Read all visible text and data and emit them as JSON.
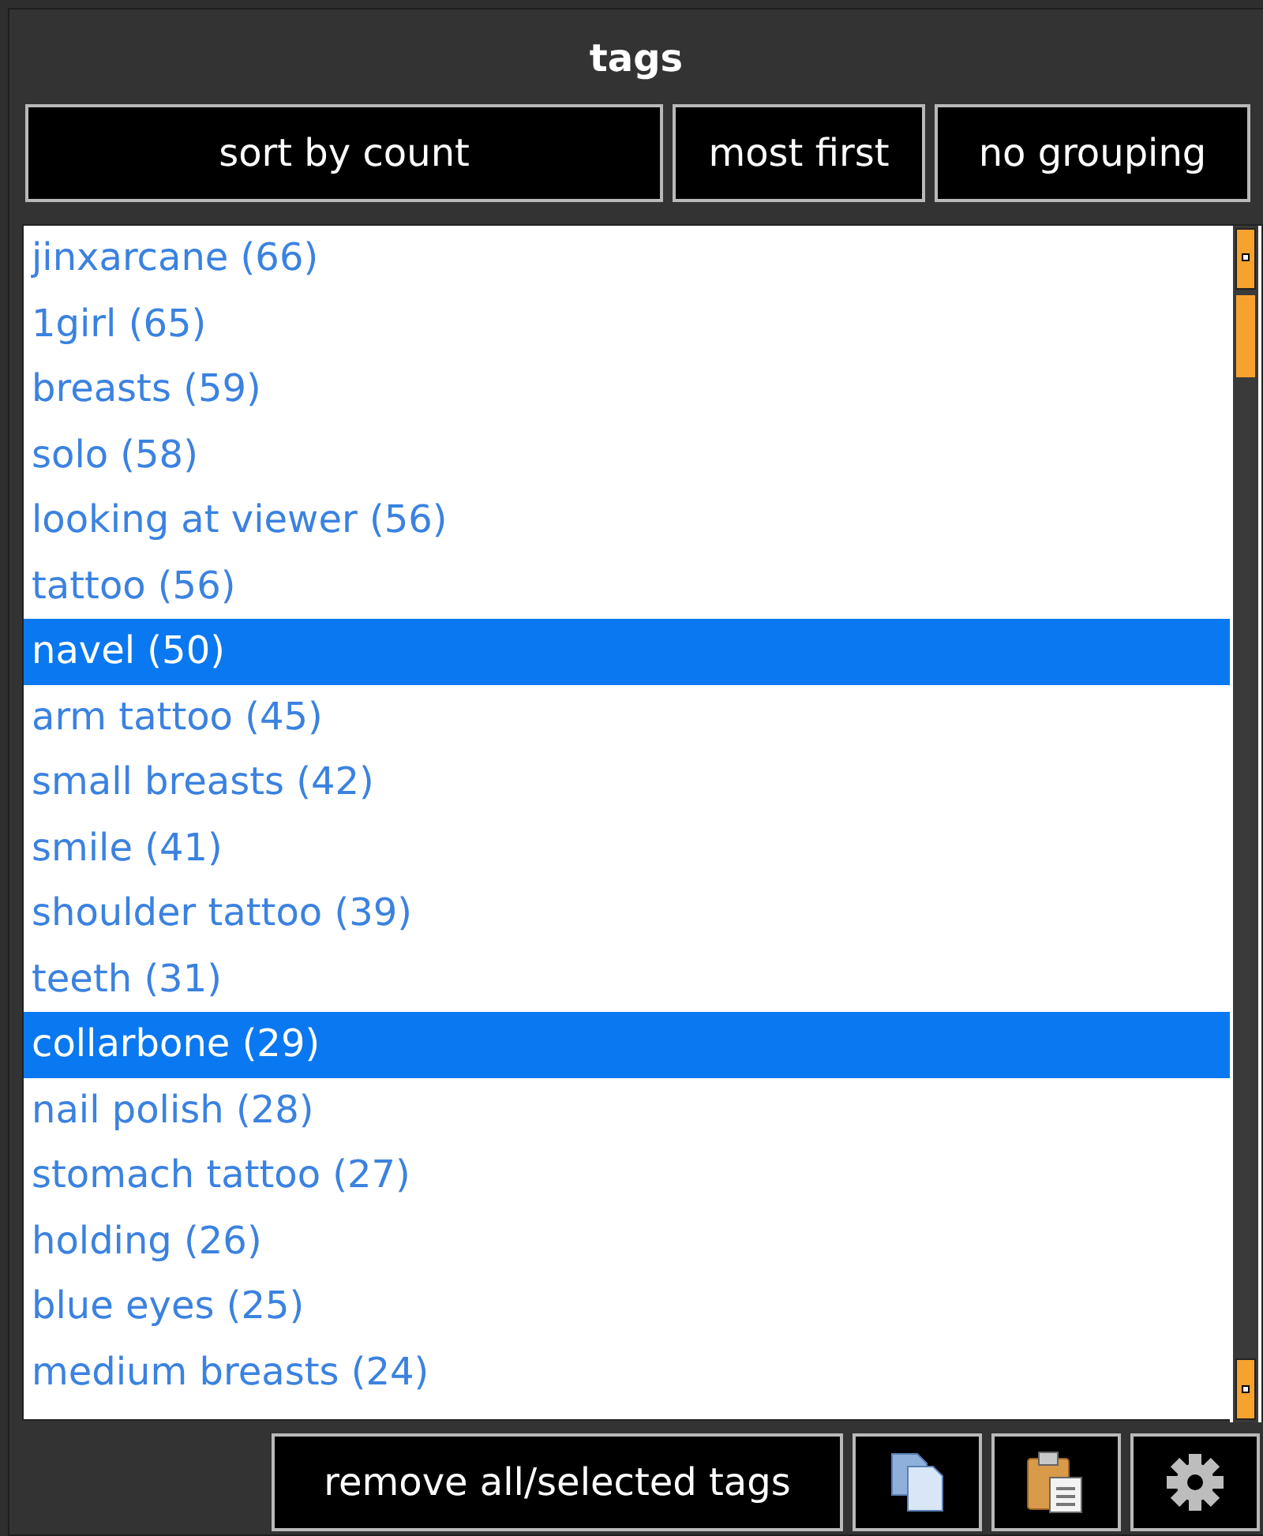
{
  "panel": {
    "title": "tags"
  },
  "sort_buttons": [
    "sort by count",
    "most first",
    "no grouping"
  ],
  "tags": [
    {
      "label": "jinxarcane (66)",
      "selected": false
    },
    {
      "label": "1girl (65)",
      "selected": false
    },
    {
      "label": "breasts (59)",
      "selected": false
    },
    {
      "label": "solo (58)",
      "selected": false
    },
    {
      "label": "looking at viewer (56)",
      "selected": false
    },
    {
      "label": "tattoo (56)",
      "selected": false
    },
    {
      "label": "navel (50)",
      "selected": true
    },
    {
      "label": "arm tattoo (45)",
      "selected": false
    },
    {
      "label": "small breasts (42)",
      "selected": false
    },
    {
      "label": "smile (41)",
      "selected": false
    },
    {
      "label": "shoulder tattoo (39)",
      "selected": false
    },
    {
      "label": "teeth (31)",
      "selected": false
    },
    {
      "label": "collarbone (29)",
      "selected": true
    },
    {
      "label": "nail polish (28)",
      "selected": false
    },
    {
      "label": "stomach tattoo (27)",
      "selected": false
    },
    {
      "label": "holding (26)",
      "selected": false
    },
    {
      "label": "blue eyes (25)",
      "selected": false
    },
    {
      "label": "medium breasts (24)",
      "selected": false
    }
  ],
  "bottom_buttons": [
    {
      "kind": "text",
      "label": "remove all/selected tags"
    },
    {
      "kind": "copy"
    },
    {
      "kind": "paste"
    },
    {
      "kind": "settings"
    }
  ]
}
